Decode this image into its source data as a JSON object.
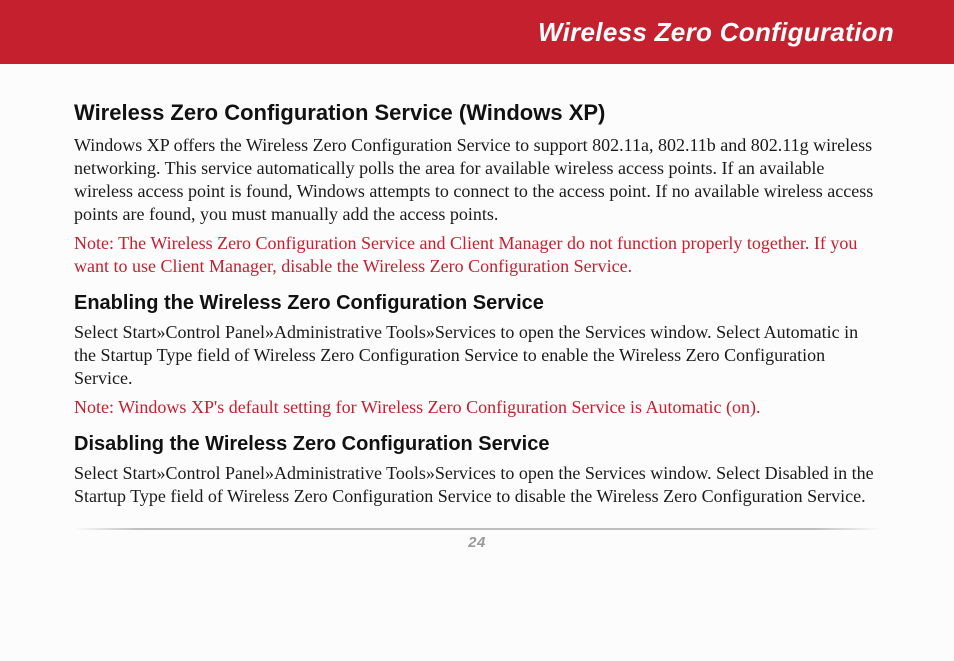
{
  "banner": {
    "title": "Wireless Zero Configuration"
  },
  "section1": {
    "heading": "Wireless Zero Configuration Service (Windows XP)",
    "body": "Windows XP offers the Wireless Zero Configuration Service to support 802.11a, 802.11b and 802.11g wireless networking. This service automatically polls the area for available wireless access points. If an available wireless access point is found, Windows attempts to connect to the access point. If no available wireless access points are found, you must manually add the access points.",
    "note": "Note: The Wireless Zero Configuration Service and Client Manager do not function properly together. If you want to use Client Manager, disable the Wireless Zero Configuration Service."
  },
  "section2": {
    "heading": "Enabling the Wireless Zero Configuration Service",
    "body": "Select Start»Control Panel»Administrative Tools»Services to open the Services window. Select Automatic in the Startup Type field of Wireless Zero Configuration Service to enable the Wireless Zero Configuration Service.",
    "note": "Note: Windows XP's default setting for Wireless Zero Configuration Service is Automatic (on)."
  },
  "section3": {
    "heading": "Disabling the Wireless Zero Configuration Service",
    "body": "Select Start»Control Panel»Administrative Tools»Services to open the Services window. Select Disabled in the Startup Type field of Wireless Zero Configuration Service to disable the Wireless Zero Configuration Service."
  },
  "footer": {
    "page": "24"
  }
}
